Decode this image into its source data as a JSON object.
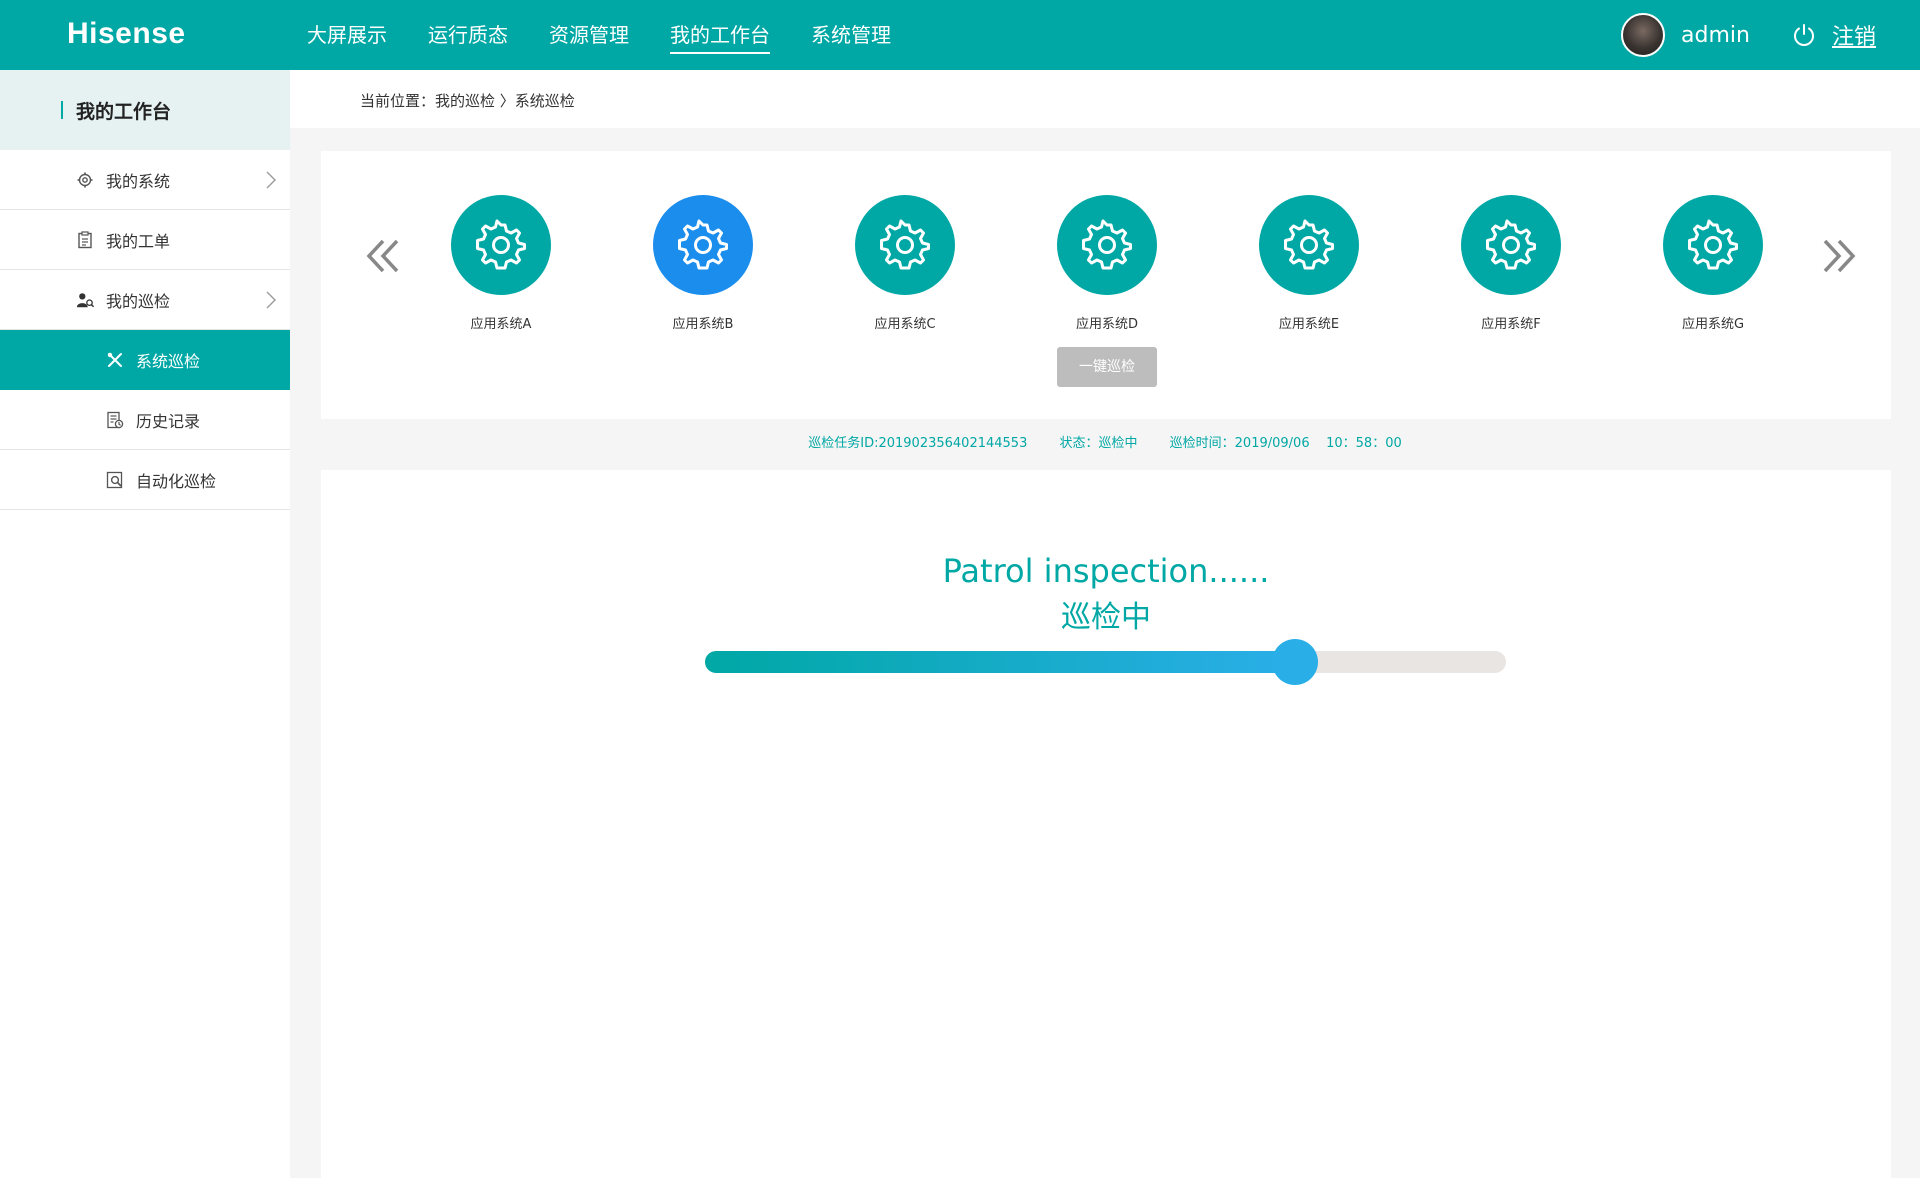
{
  "brand": {
    "logo_text": "Hisense"
  },
  "nav": {
    "items": [
      {
        "label": "大屏展示",
        "active": false
      },
      {
        "label": "运行质态",
        "active": false
      },
      {
        "label": "资源管理",
        "active": false
      },
      {
        "label": "我的工作台",
        "active": true
      },
      {
        "label": "系统管理",
        "active": false
      }
    ]
  },
  "user": {
    "name": "admin",
    "logout_label": "注销"
  },
  "sidebar": {
    "title": "我的工作台",
    "items": [
      {
        "label": "我的系统",
        "icon": "gear-icon",
        "has_chevron": true
      },
      {
        "label": "我的工单",
        "icon": "clipboard-icon",
        "has_chevron": false
      },
      {
        "label": "我的巡检",
        "icon": "inspector-icon",
        "has_chevron": true
      },
      {
        "label": "系统巡检",
        "icon": "tools-icon",
        "active": true
      },
      {
        "label": "历史记录",
        "icon": "history-icon"
      },
      {
        "label": "自动化巡检",
        "icon": "auto-search-icon"
      }
    ]
  },
  "breadcrumb": {
    "text": "当前位置：我的巡检 〉系统巡检"
  },
  "systems": {
    "items": [
      {
        "label": "应用系统A",
        "selected": false
      },
      {
        "label": "应用系统B",
        "selected": true
      },
      {
        "label": "应用系统C",
        "selected": false
      },
      {
        "label": "应用系统D",
        "selected": false
      },
      {
        "label": "应用系统E",
        "selected": false
      },
      {
        "label": "应用系统F",
        "selected": false
      },
      {
        "label": "应用系统G",
        "selected": false
      }
    ],
    "patrol_button_label": "一键巡检"
  },
  "task": {
    "id_text": "巡检任务ID:201902356402144553",
    "status_text": "状态：巡检中",
    "time_text": "巡检时间：2019/09/06    10：58：00"
  },
  "progress": {
    "title_en": "Patrol inspection......",
    "title_cn": "巡检中",
    "value": 0.736
  },
  "colors": {
    "primary": "#00a8a5",
    "selected": "#1a8ded",
    "progress_end": "#2aaee8",
    "button_disabled": "#bdbdbd"
  }
}
